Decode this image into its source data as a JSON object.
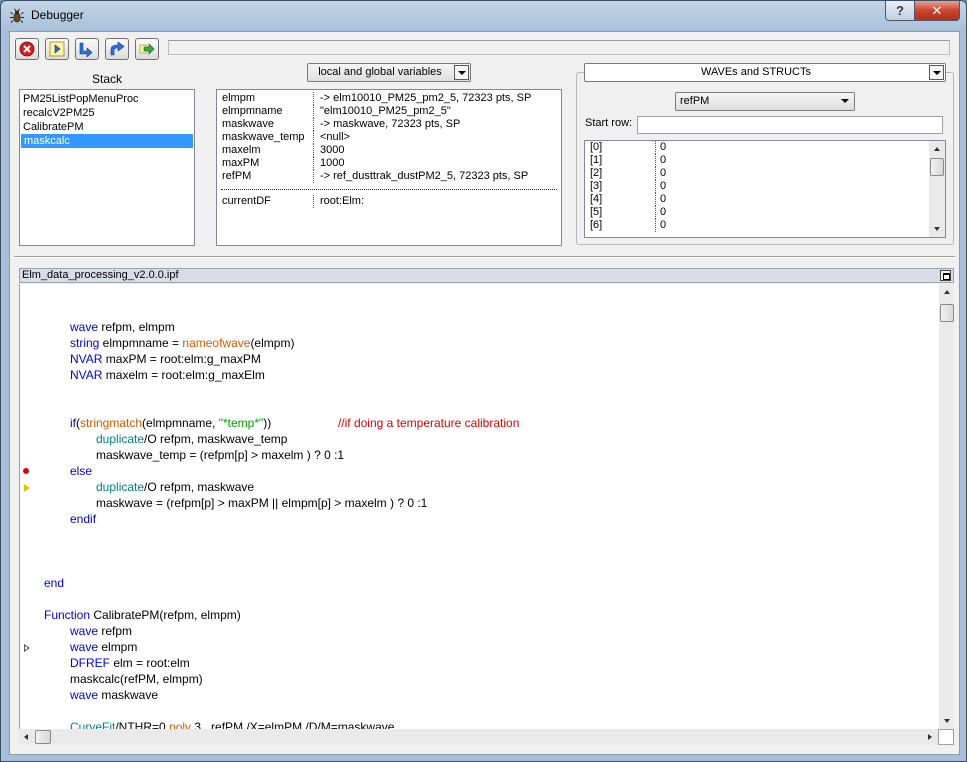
{
  "window": {
    "title": "Debugger"
  },
  "titlebar": {
    "help_label": "?",
    "close_label": "✕"
  },
  "toolbar": {
    "buttons": [
      {
        "name": "stop-button",
        "icon": "stop-icon"
      },
      {
        "name": "go-button",
        "icon": "run-icon"
      },
      {
        "name": "step-into-button",
        "icon": "step-into-icon"
      },
      {
        "name": "step-over-button",
        "icon": "step-over-icon"
      },
      {
        "name": "step-out-button",
        "icon": "step-out-icon"
      }
    ]
  },
  "stack": {
    "label": "Stack",
    "items": [
      "PM25ListPopMenuProc",
      "recalcV2PM25",
      "CalibratePM",
      "maskcalc"
    ],
    "selected_index": 3
  },
  "variables": {
    "scope_dropdown": "local and global variables",
    "rows": [
      {
        "name": "elmpm",
        "value": "-> elm10010_PM25_pm2_5, 72323 pts, SP"
      },
      {
        "name": "elmpmname",
        "value": "\"elm10010_PM25_pm2_5\""
      },
      {
        "name": "maskwave",
        "value": "-> maskwave, 72323 pts, SP"
      },
      {
        "name": "maskwave_temp",
        "value": "<null>"
      },
      {
        "name": "maxelm",
        "value": "3000"
      },
      {
        "name": "maxPM",
        "value": "1000"
      },
      {
        "name": "refPM",
        "value": "-> ref_dusttrak_dustPM2_5, 72323 pts, SP"
      }
    ],
    "global_rows": [
      {
        "name": "currentDF",
        "value": "root:Elm:"
      }
    ]
  },
  "waves": {
    "type_dropdown": "WAVEs and STRUCTs",
    "wave_dropdown": "refPM",
    "start_row_label": "Start row:",
    "start_row_value": "",
    "rows": [
      {
        "index": "[0]",
        "value": "0"
      },
      {
        "index": "[1]",
        "value": "0"
      },
      {
        "index": "[2]",
        "value": "0"
      },
      {
        "index": "[3]",
        "value": "0"
      },
      {
        "index": "[4]",
        "value": "0"
      },
      {
        "index": "[5]",
        "value": "0"
      },
      {
        "index": "[6]",
        "value": "0"
      }
    ]
  },
  "code": {
    "file_name": "Elm_data_processing_v2.0.0.ipf",
    "breakpoint_line": 11,
    "current_line": 12,
    "caller_line": 22
  },
  "colors": {
    "keyword": "#0000dd",
    "function": "#d05a00",
    "operation": "#008080",
    "string": "#00a000",
    "comment": "#dd0000",
    "selection": "#3399ff"
  }
}
